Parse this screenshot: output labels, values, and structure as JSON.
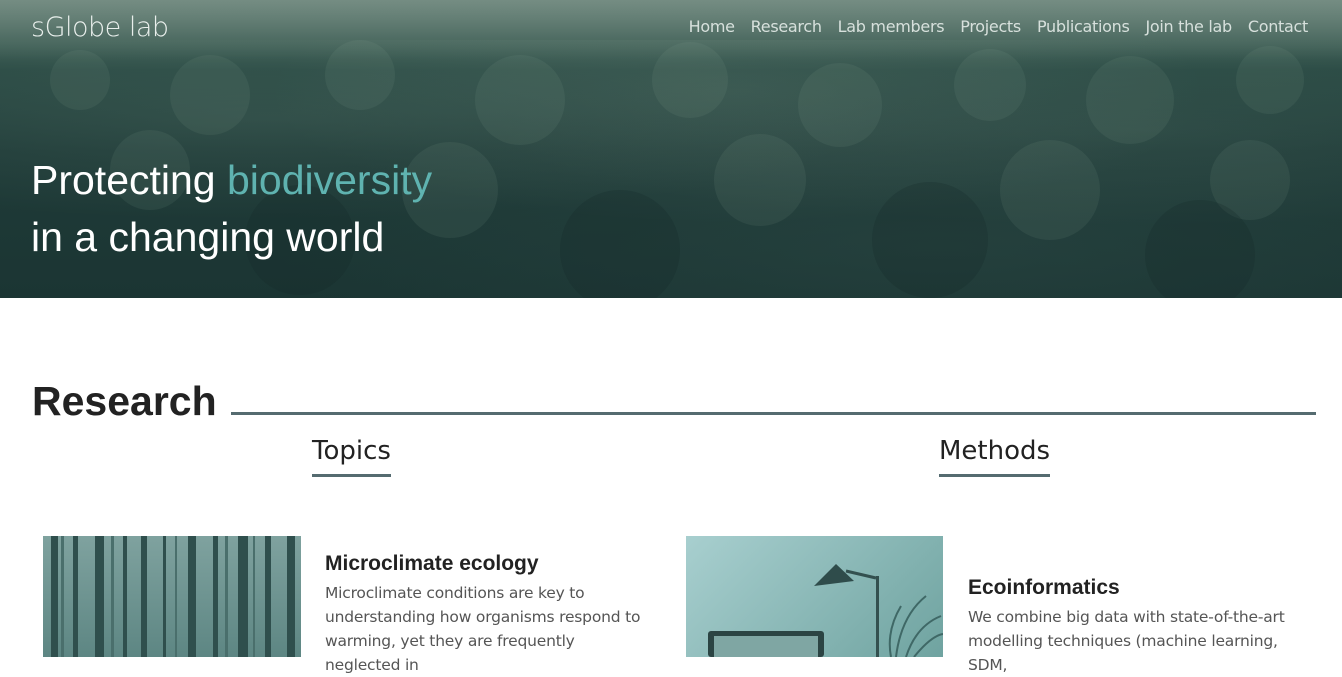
{
  "brand": {
    "logo_text": "sGlobe lab"
  },
  "nav": {
    "items": [
      {
        "label": "Home"
      },
      {
        "label": "Research"
      },
      {
        "label": "Lab members"
      },
      {
        "label": "Projects"
      },
      {
        "label": "Publications"
      },
      {
        "label": "Join the lab"
      },
      {
        "label": "Contact"
      }
    ]
  },
  "hero": {
    "line1_prefix": "Protecting ",
    "line1_accent": "biodiversity",
    "line2": "in a changing world",
    "accent_color": "#5fb3b0"
  },
  "research": {
    "title": "Research",
    "topics_heading": "Topics",
    "methods_heading": "Methods",
    "topic_card": {
      "title": "Microclimate ecology",
      "text": "Microclimate conditions are key to understanding how organisms respond to warming, yet they are frequently neglected in"
    },
    "method_card": {
      "title": "Ecoinformatics",
      "text": "We combine big data with state-of-the-art modelling techniques (machine learning, SDM,"
    }
  }
}
